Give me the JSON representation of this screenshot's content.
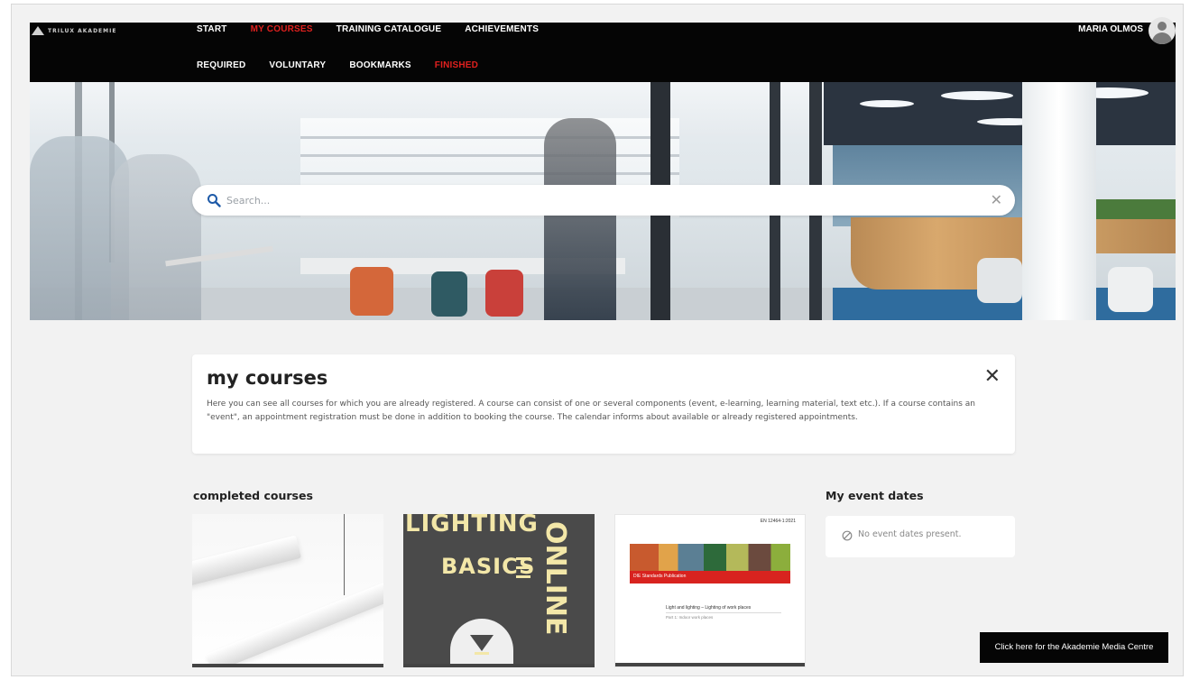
{
  "header": {
    "logo_text": "TRILUX AKADEMIE",
    "main_nav": [
      {
        "label": "START",
        "active": false
      },
      {
        "label": "MY COURSES",
        "active": true
      },
      {
        "label": "TRAINING CATALOGUE",
        "active": false
      },
      {
        "label": "ACHIEVEMENTS",
        "active": false
      }
    ],
    "sub_nav": [
      {
        "label": "REQUIRED",
        "active": false
      },
      {
        "label": "VOLUNTARY",
        "active": false
      },
      {
        "label": "BOOKMARKS",
        "active": false
      },
      {
        "label": "FINISHED",
        "active": true
      }
    ],
    "user_name": "MARIA OLMOS",
    "accent_color": "#e0201e"
  },
  "search": {
    "placeholder": "Search...",
    "value": ""
  },
  "info": {
    "title": "my courses",
    "text": "Here you can see all courses for which you are already registered. A course can consist of one or several components (event, e-learning, learning material, text etc.). If a course contains an \"event\", an appointment registration must be done in addition to booking the course. The calendar informs about available or already registered appointments."
  },
  "completed": {
    "title": "completed courses",
    "courses": [
      {
        "kind": "luminaire-photo"
      },
      {
        "line1": "LIGHTING",
        "line2": "BASICS",
        "side": "ONLINE"
      },
      {
        "top_text": "EN 12464-1:2021",
        "banner": "DIE Standards Publication",
        "heading": "Light and lighting – Lighting of work places",
        "subheading": "Part 1: Indoor work places"
      }
    ]
  },
  "events": {
    "title": "My event dates",
    "empty_text": "No event dates present."
  },
  "media_button": {
    "label": "Click here for the Akademie Media Centre"
  }
}
